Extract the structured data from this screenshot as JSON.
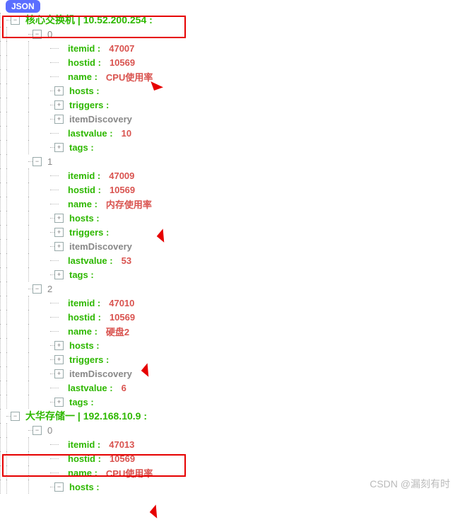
{
  "badge": "JSON",
  "watermark": "CSDN @漏刻有时",
  "toggle_minus": "−",
  "toggle_plus": "+",
  "labels": {
    "itemid": "itemid :",
    "hostid": "hostid :",
    "name": "name :",
    "hosts": "hosts :",
    "triggers": "triggers :",
    "itemDiscovery": "itemDiscovery",
    "lastvalue": "lastvalue :",
    "tags": "tags :"
  },
  "hosts": [
    {
      "title": "核心交换机 | 10.52.200.254 :",
      "items": [
        {
          "idx": "0",
          "itemid": "47007",
          "hostid": "10569",
          "name": "CPU使用率",
          "lastvalue": "10"
        },
        {
          "idx": "1",
          "itemid": "47009",
          "hostid": "10569",
          "name": "内存使用率",
          "lastvalue": "53"
        },
        {
          "idx": "2",
          "itemid": "47010",
          "hostid": "10569",
          "name": "硬盘2",
          "lastvalue": "6"
        }
      ]
    },
    {
      "title": "大华存储一 | 192.168.10.9 :",
      "items": [
        {
          "idx": "0",
          "itemid": "47013",
          "hostid": "10569",
          "name": "CPU使用率",
          "lastvalue": ""
        }
      ]
    }
  ]
}
